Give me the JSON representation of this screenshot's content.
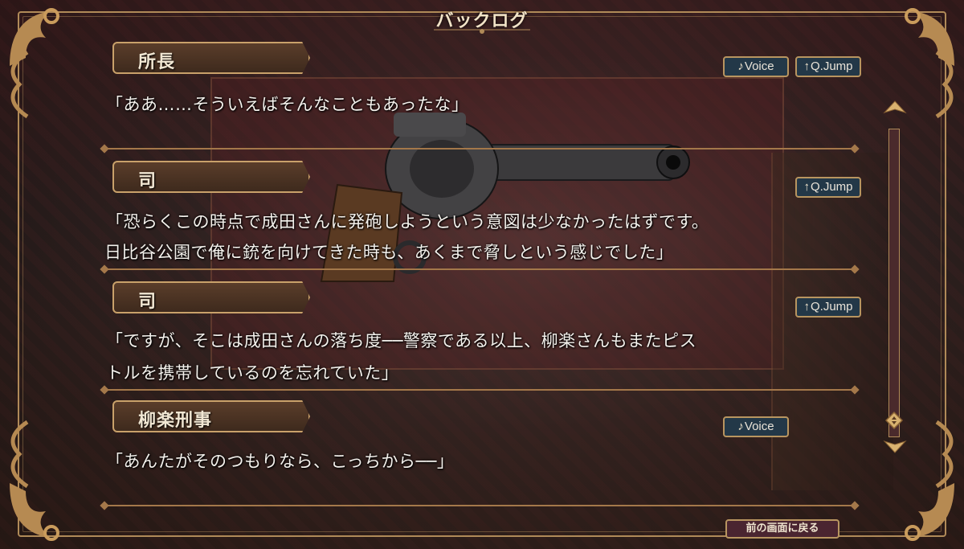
{
  "screen": {
    "title": "バックログ"
  },
  "entries": [
    {
      "speaker": "所長",
      "lines": [
        "「ああ……そういえばそんなこともあったな」"
      ],
      "voice_label": "Voice",
      "jump_label": "Q.Jump"
    },
    {
      "speaker": "司",
      "lines": [
        "「恐らくこの時点で成田さんに発砲しようという意図は少なかったはずです。",
        "日比谷公園で俺に銃を向けてきた時も、あくまで脅しという感じでした」"
      ],
      "jump_label": "Q.Jump"
    },
    {
      "speaker": "司",
      "lines": [
        "「ですが、そこは成田さんの落ち度──警察である以上、柳楽さんもまたピス",
        "トルを携帯しているのを忘れていた」"
      ],
      "jump_label": "Q.Jump"
    },
    {
      "speaker": "柳楽刑事",
      "lines": [
        "「あんたがそのつもりなら、こっちから──」"
      ],
      "voice_label": "Voice"
    }
  ],
  "footer": {
    "back_label": "前の画面に戻る"
  },
  "icons": {
    "voice": "music-note-icon",
    "jump": "up-arrow-icon"
  },
  "colors": {
    "frame_gold": "#b08a58",
    "button_fill": "#233848",
    "name_plate": "#4a3222"
  }
}
